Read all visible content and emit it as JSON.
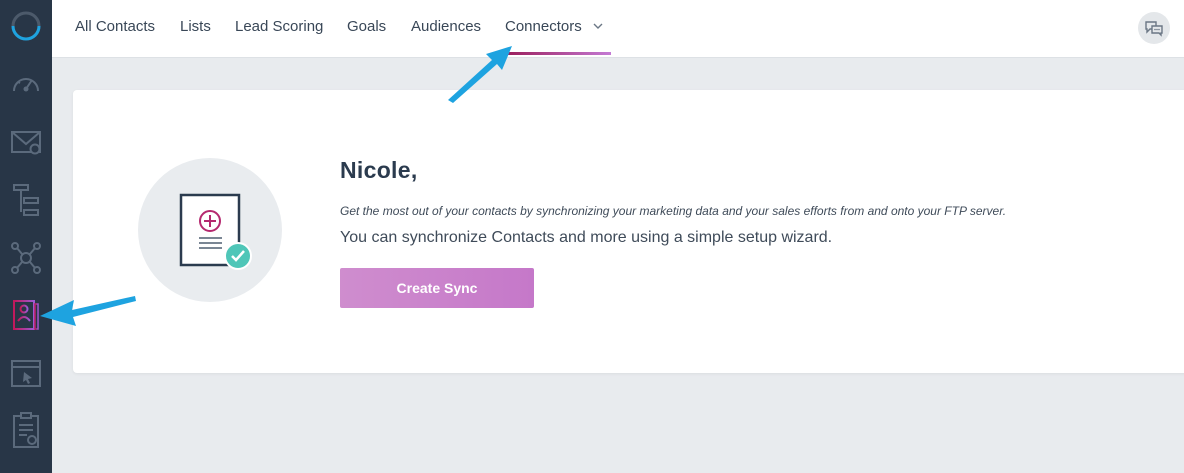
{
  "nav": {
    "items": [
      {
        "label": "All Contacts"
      },
      {
        "label": "Lists"
      },
      {
        "label": "Lead Scoring"
      },
      {
        "label": "Goals"
      },
      {
        "label": "Audiences"
      },
      {
        "label": "Connectors",
        "active": true,
        "has_dropdown": true
      }
    ],
    "chevron": "⌄"
  },
  "sidebar": {
    "items": [
      {
        "icon": "logo-ring-icon"
      },
      {
        "icon": "dashboard-gauge-icon"
      },
      {
        "icon": "email-campaign-icon"
      },
      {
        "icon": "automation-flow-icon"
      },
      {
        "icon": "network-integrations-icon"
      },
      {
        "icon": "contacts-card-icon",
        "active": true
      },
      {
        "icon": "landing-page-icon"
      },
      {
        "icon": "forms-clipboard-icon"
      }
    ]
  },
  "main": {
    "greeting": "Nicole,",
    "description_italic": "Get the most out of your contacts by synchronizing your marketing data and your sales efforts from and onto your FTP server.",
    "description": "You can synchronize Contacts and more using a simple setup wizard.",
    "create_button_label": "Create Sync"
  },
  "colors": {
    "sidebar_bg": "#283647",
    "accent_pink": "#c578c9",
    "annotation_arrow": "#1ea3e0",
    "active_underline_start": "#9a1c59",
    "active_underline_end": "#c47ad4"
  }
}
